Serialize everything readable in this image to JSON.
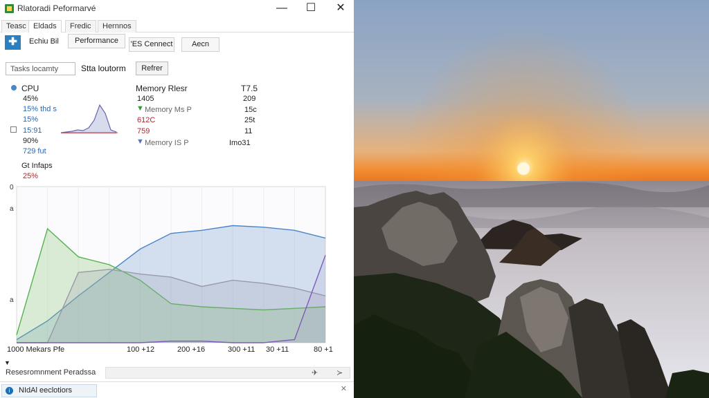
{
  "window": {
    "title": "Rlatoradi Peformarvé",
    "minimize": "—",
    "maximize": "☐",
    "close": "✕"
  },
  "tabs": [
    {
      "label": "Teasc"
    },
    {
      "label": "Eldads"
    },
    {
      "label": "Fredic"
    },
    {
      "label": "Hernnos"
    }
  ],
  "toolbar": {
    "icon": "plus-icon",
    "label": "Echiu Bil",
    "performance_btn": "Performance",
    "connect_btn": "'ES Cennect",
    "search_btn": "Aecn"
  },
  "filter": {
    "value": "Tasks locamty",
    "title": "Stta loutorm",
    "refresh_btn": "Refrer"
  },
  "cpu": {
    "label": "CPU",
    "val1": "45%",
    "val2": "15% thd s",
    "val3": "15%",
    "val4": "15:91",
    "val5": "90%",
    "val6": "729 fut"
  },
  "memory": {
    "header": "Memory Rlesr",
    "header_right": "T7.5",
    "row1_l": "1405",
    "row1_r": "209",
    "row2_l": "Memory Ms P",
    "row2_r": "15c",
    "row3_l": "612C",
    "row3_r": "25t",
    "row4_l": "759",
    "row4_r": "11",
    "row5_l": "Memory IS P",
    "row5_r": "Imo31"
  },
  "graph": {
    "label": "Gt Infaps",
    "value": "25%",
    "y_ticks": [
      "0",
      "a",
      "a"
    ],
    "x_ticks": [
      "1000 Mekars Pfe",
      "100 +12",
      "200 +16",
      "300 +11",
      "30 +11",
      "80 +1"
    ]
  },
  "colors": {
    "cpu_blue": "#4a84c8",
    "memory_green": "#55b24f",
    "disk_purple": "#7d5bb8",
    "other_gray": "#9a9aa6",
    "accent": "#2a7fc0"
  },
  "chart_data": {
    "type": "area",
    "x": [
      0,
      10,
      20,
      30,
      40,
      50,
      60,
      70,
      80,
      90,
      100
    ],
    "series": [
      {
        "values": [
          2,
          14,
          30,
          45,
          60,
          70,
          72,
          75,
          74,
          72,
          67
        ]
      },
      {
        "values": [
          5,
          73,
          55,
          50,
          40,
          25,
          23,
          22,
          21,
          22,
          23
        ]
      },
      {
        "values": [
          0,
          0,
          45,
          47,
          44,
          42,
          36,
          40,
          38,
          35,
          30
        ]
      },
      {
        "values": [
          0,
          0,
          0,
          0,
          0,
          1,
          1,
          0,
          0,
          2,
          56
        ]
      }
    ],
    "ylim": [
      0,
      100
    ],
    "grid": true
  },
  "footer": {
    "title": "Resesromnment Peradssa",
    "bar_right1": "✈",
    "bar_right2": "≻"
  },
  "status": {
    "tab_label": "NIdAl eeclotiors",
    "close": "✕"
  }
}
